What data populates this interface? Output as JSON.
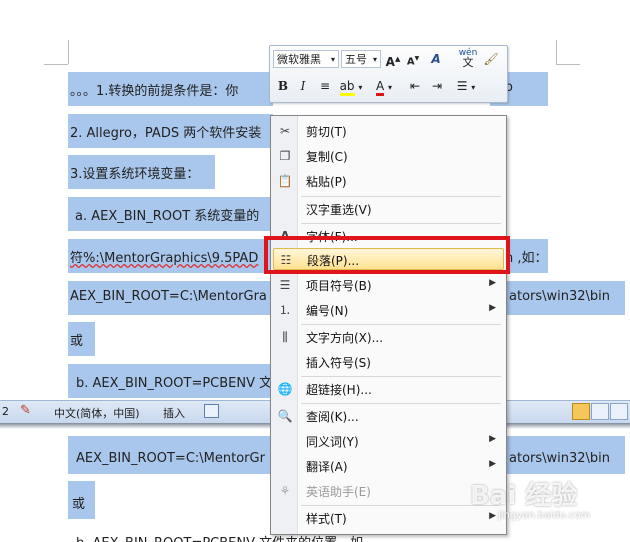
{
  "document": {
    "lines": [
      "。。。1.转换的前提条件是：你",
      "2. Allegro，PADS 两个软件安装",
      "3.设置系统环境变量：",
      "a. AEX_BIN_ROOT  系统变量的",
      "符%:\\MentorGraphics\\9.5PAD",
      "AEX_BIN_ROOT=C:\\MentorGra",
      "或",
      "b. AEX_BIN_ROOT=PCBENV 文",
      "AEX_BIN_ROOT=C:\\MentorGr",
      "或",
      "b. AEX_BIN_ROOT=PCBENV 文件夹的位置，如"
    ],
    "right_fragments": {
      "line1": "ro",
      "line5": "n ,如：",
      "line6": "ators\\win32\\bin",
      "line9": "ators\\win32\\bin"
    }
  },
  "statusbar": {
    "page_num": "2",
    "language": "中文(简体，中国)",
    "mode": "插入"
  },
  "mini_toolbar": {
    "font_name": "微软雅黑",
    "font_size": "五号",
    "grow_font": "A",
    "shrink_font": "A",
    "styles": "A",
    "phonetic_top": "wén",
    "phonetic_bottom": "文",
    "bold": "B",
    "italic": "I",
    "font_color": "A"
  },
  "context_menu": {
    "items": [
      {
        "label": "剪切(T)",
        "icon": "scissors-icon"
      },
      {
        "label": "复制(C)",
        "icon": "copy-icon"
      },
      {
        "label": "粘贴(P)",
        "icon": "paste-icon"
      },
      {
        "label": "汉字重选(V)",
        "icon": ""
      },
      {
        "label": "字体(F)...",
        "icon": "font-icon"
      },
      {
        "label": "段落(P)...",
        "icon": "paragraph-icon",
        "highlighted": true
      },
      {
        "label": "项目符号(B)",
        "icon": "bullets-icon",
        "submenu": true
      },
      {
        "label": "编号(N)",
        "icon": "numbering-icon",
        "submenu": true
      },
      {
        "label": "文字方向(X)...",
        "icon": "text-direction-icon"
      },
      {
        "label": "插入符号(S)",
        "icon": ""
      },
      {
        "label": "超链接(H)...",
        "icon": "hyperlink-icon"
      },
      {
        "label": "查阅(K)...",
        "icon": "research-icon"
      },
      {
        "label": "同义词(Y)",
        "icon": "",
        "submenu": true
      },
      {
        "label": "翻译(A)",
        "icon": "",
        "submenu": true
      },
      {
        "label": "英语助手(E)",
        "icon": "english-assistant-icon",
        "disabled": true
      },
      {
        "label": "样式(T)",
        "icon": "",
        "submenu": true
      }
    ]
  },
  "watermark": {
    "text": "Bai 经验",
    "sub": "jingyan.baidu.com"
  },
  "colors": {
    "selection": "#a9c7ec",
    "highlight_border": "#e0141b",
    "menu_hover": "#ffe191"
  }
}
